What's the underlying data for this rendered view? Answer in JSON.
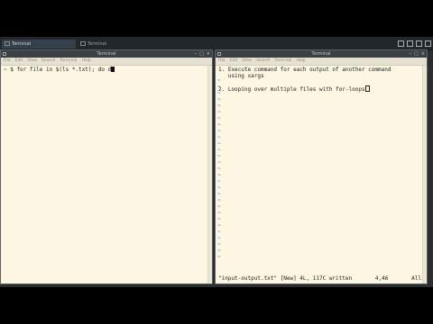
{
  "taskbar": {
    "tasks": [
      {
        "label": "Terminal",
        "active": true
      },
      {
        "label": "Terminal",
        "active": false
      }
    ],
    "tray_icons": [
      "network-icon",
      "volume-icon",
      "battery-icon",
      "power-icon"
    ]
  },
  "left_window": {
    "title": "Terminal",
    "controls": [
      "–",
      "□",
      "×"
    ],
    "menu": [
      "File",
      "Edit",
      "View",
      "Search",
      "Terminal",
      "Help"
    ],
    "command_line": "~ $ for file in $(ls *.txt); do d"
  },
  "right_window": {
    "title": "Terminal",
    "controls": [
      "–",
      "□",
      "×"
    ],
    "menu": [
      "File",
      "Edit",
      "View",
      "Search",
      "Terminal",
      "Help"
    ],
    "lines": [
      "1. Execute command for each output of another command",
      "   using xargs",
      "",
      "2. Looping over multiple files with for-loops"
    ],
    "status_left": "\"input-output.txt\" [New] 4L, 117C written",
    "status_pos": "4,46",
    "status_right": "All"
  },
  "colors": {
    "terminal_bg": "#fdf6e3",
    "tilde": "#2c6fb0",
    "desktop": "#2b2e30"
  }
}
